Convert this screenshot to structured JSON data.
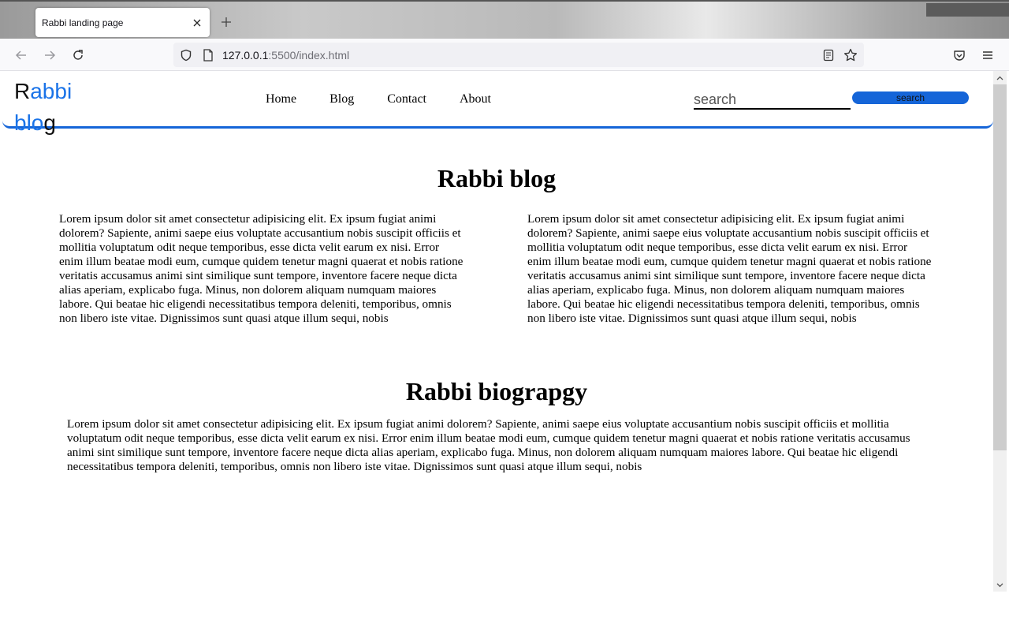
{
  "browser": {
    "tab_title": "Rabbi landing page",
    "url_host": "127.0.0.1",
    "url_path": ":5500/index.html"
  },
  "site": {
    "logo_r": "R",
    "logo_abbi": "abbi",
    "logo_blo": "blo",
    "logo_g": "g",
    "nav": [
      "Home",
      "Blog",
      "Contact",
      "About"
    ],
    "search_placeholder": "search",
    "search_button": "search",
    "accent_color": "#1565d8"
  },
  "main": {
    "blog_heading": "Rabbi blog",
    "blog_left": "Lorem ipsum dolor sit amet consectetur adipisicing elit. Ex ipsum fugiat animi dolorem? Sapiente, animi saepe eius voluptate accusantium nobis suscipit officiis et mollitia voluptatum odit neque temporibus, esse dicta velit earum ex nisi. Error enim illum beatae modi eum, cumque quidem tenetur magni quaerat et nobis ratione veritatis accusamus animi sint similique sunt tempore, inventore facere neque dicta alias aperiam, explicabo fuga. Minus, non dolorem aliquam numquam maiores labore. Qui beatae hic eligendi necessitatibus tempora deleniti, temporibus, omnis non libero iste vitae. Dignissimos sunt quasi atque illum sequi, nobis",
    "blog_right": "Lorem ipsum dolor sit amet consectetur adipisicing elit. Ex ipsum fugiat animi dolorem? Sapiente, animi saepe eius voluptate accusantium nobis suscipit officiis et mollitia voluptatum odit neque temporibus, esse dicta velit earum ex nisi. Error enim illum beatae modi eum, cumque quidem tenetur magni quaerat et nobis ratione veritatis accusamus animi sint similique sunt tempore, inventore facere neque dicta alias aperiam, explicabo fuga. Minus, non dolorem aliquam numquam maiores labore. Qui beatae hic eligendi necessitatibus tempora deleniti, temporibus, omnis non libero iste vitae. Dignissimos sunt quasi atque illum sequi, nobis",
    "bio_heading": "Rabbi biograpgy",
    "bio_text": "Lorem ipsum dolor sit amet consectetur adipisicing elit. Ex ipsum fugiat animi dolorem? Sapiente, animi saepe eius voluptate accusantium nobis suscipit officiis et mollitia voluptatum odit neque temporibus, esse dicta velit earum ex nisi. Error enim illum beatae modi eum, cumque quidem tenetur magni quaerat et nobis ratione veritatis accusamus animi sint similique sunt tempore, inventore facere neque dicta alias aperiam, explicabo fuga. Minus, non dolorem aliquam numquam maiores labore. Qui beatae hic eligendi necessitatibus tempora deleniti, temporibus, omnis non libero iste vitae. Dignissimos sunt quasi atque illum sequi, nobis"
  },
  "icons": {
    "back": "arrow-left-icon",
    "forward": "arrow-right-icon",
    "reload": "reload-icon",
    "shield": "shield-icon",
    "page": "page-icon",
    "reader": "reader-view-icon",
    "bookmark": "star-icon",
    "pocket": "pocket-icon",
    "menu": "hamburger-menu-icon"
  }
}
